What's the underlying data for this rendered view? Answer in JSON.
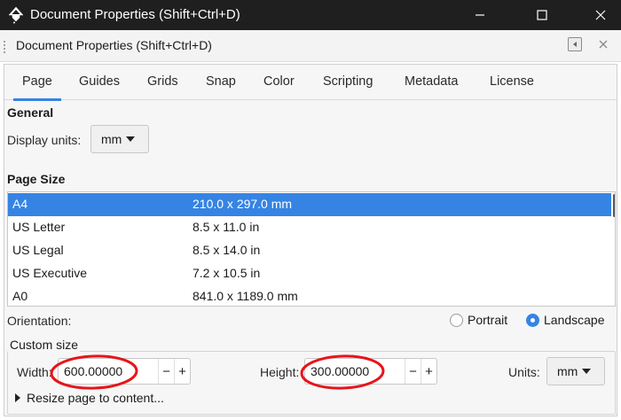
{
  "window": {
    "title": "Document Properties (Shift+Ctrl+D)",
    "logo_icon": "inkscape-logo-icon",
    "controls": [
      "minimize-icon",
      "maximize-icon",
      "close-icon"
    ]
  },
  "dock": {
    "title": "Document Properties (Shift+Ctrl+D)"
  },
  "tabs": [
    {
      "label": "Page",
      "active": true
    },
    {
      "label": "Guides"
    },
    {
      "label": "Grids"
    },
    {
      "label": "Snap"
    },
    {
      "label": "Color"
    },
    {
      "label": "Scripting"
    },
    {
      "label": "Metadata"
    },
    {
      "label": "License"
    }
  ],
  "general": {
    "title": "General",
    "display_units_label": "Display units:",
    "display_units_value": "mm"
  },
  "page_size": {
    "title": "Page Size",
    "rows": [
      {
        "name": "A4",
        "dims": "210.0 x 297.0 mm",
        "selected": true
      },
      {
        "name": "US Letter",
        "dims": "8.5 x 11.0 in"
      },
      {
        "name": "US Legal",
        "dims": "8.5 x 14.0 in"
      },
      {
        "name": "US Executive",
        "dims": "7.2 x 10.5 in"
      },
      {
        "name": "A0",
        "dims": "841.0 x 1189.0 mm"
      }
    ]
  },
  "orientation": {
    "label": "Orientation:",
    "portrait": "Portrait",
    "landscape": "Landscape",
    "selected": "Landscape"
  },
  "custom_size": {
    "legend": "Custom size",
    "width_label": "Width:",
    "width_value": "600.00000",
    "height_label": "Height:",
    "height_value": "300.00000",
    "units_label": "Units:",
    "units_value": "mm",
    "minus": "−",
    "plus": "+"
  },
  "resize_label": "Resize page to content...",
  "colors": {
    "accent": "#3584e4",
    "annotation": "#e8141b",
    "titlebar": "#1f1f1f"
  }
}
